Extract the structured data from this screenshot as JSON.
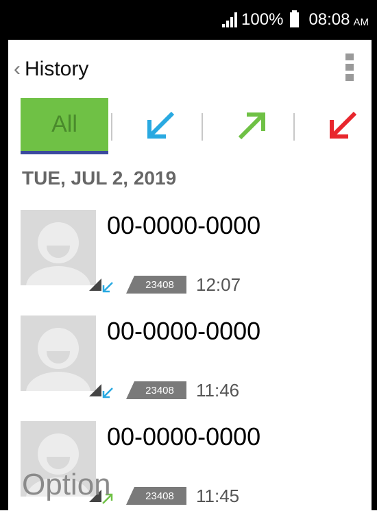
{
  "status_bar": {
    "battery": "100%",
    "time": "08:08",
    "ampm": "AM"
  },
  "header": {
    "title": "History"
  },
  "tabs": {
    "all_label": "All"
  },
  "colors": {
    "accent_green": "#6fc145",
    "incoming": "#29a9e1",
    "outgoing": "#6fc145",
    "missed": "#e8262d"
  },
  "date_header": "TUE, JUL 2, 2019",
  "calls": [
    {
      "number": "00-0000-0000",
      "sim": "23408",
      "time": "12:07",
      "type": "incoming"
    },
    {
      "number": "00-0000-0000",
      "sim": "23408",
      "time": "11:46",
      "type": "incoming"
    },
    {
      "number": "00-0000-0000",
      "sim": "23408",
      "time": "11:45",
      "type": "outgoing"
    }
  ],
  "softkeys": {
    "left": "Option"
  }
}
